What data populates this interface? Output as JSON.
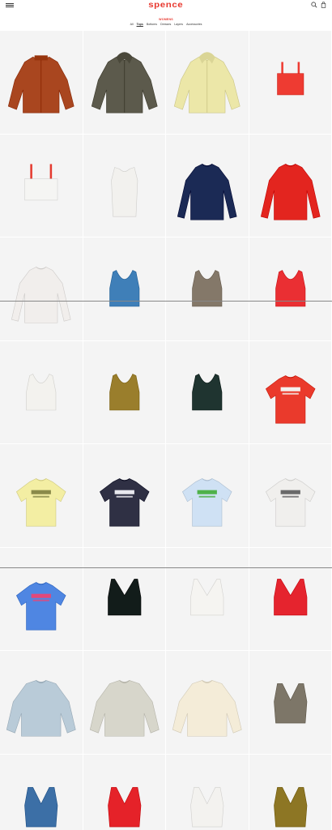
{
  "header": {
    "logo": "spence",
    "menu_icon": "hamburger-icon",
    "search_icon": "search-icon",
    "bag_icon": "bag-icon",
    "accent": "#e8382f"
  },
  "section_label": "WOMENS",
  "subnav": [
    "All",
    "Tops",
    "Bottoms",
    "Dresses",
    "Layers",
    "Accessories"
  ],
  "subnav_active": "Tops",
  "products": [
    {
      "type": "jacket",
      "color": "#a9461f",
      "pattern": true
    },
    {
      "type": "hoodie",
      "color": "#5c5a4c",
      "pattern": true
    },
    {
      "type": "hoodie",
      "color": "#ece7a8",
      "pattern": true
    },
    {
      "type": "crop",
      "color": "#ee3b32"
    },
    {
      "type": "bandeau",
      "color": "#f5f5f3",
      "strap": "#e43a2f"
    },
    {
      "type": "tank",
      "color": "#f2f1ee"
    },
    {
      "type": "longsleeve",
      "color": "#1b2a55"
    },
    {
      "type": "longsleeve",
      "color": "#e3251f"
    },
    {
      "type": "longsleeve",
      "color": "#f1eeec"
    },
    {
      "type": "racer",
      "color": "#3f7fb8"
    },
    {
      "type": "racer",
      "color": "#847869"
    },
    {
      "type": "racer",
      "color": "#ea2f33"
    },
    {
      "type": "racer",
      "color": "#f3f2ee"
    },
    {
      "type": "racer",
      "color": "#9a7e2c"
    },
    {
      "type": "racer",
      "color": "#1f3430"
    },
    {
      "type": "tee",
      "color": "#ea3a2c",
      "print": "#f4f0ee"
    },
    {
      "type": "tee",
      "color": "#f3eea3",
      "print": "#8a8a4a"
    },
    {
      "type": "tee",
      "color": "#2f3044",
      "print": "#e9e9ee"
    },
    {
      "type": "tee",
      "color": "#cfe1f4",
      "print": "#4fb24a"
    },
    {
      "type": "tee",
      "color": "#f0efed",
      "print": "#6a6a6a"
    },
    {
      "type": "tee",
      "color": "#4f86e2",
      "print": "#e2487a"
    },
    {
      "type": "vcrop",
      "color": "#121c1a"
    },
    {
      "type": "vcrop",
      "color": "#f5f4f1"
    },
    {
      "type": "vcrop",
      "color": "#e5242e"
    },
    {
      "type": "sweat",
      "color": "#b9cbd8",
      "pattern": true
    },
    {
      "type": "sweat",
      "color": "#d7d6cb",
      "pattern": true
    },
    {
      "type": "sweat",
      "color": "#f4ecd8",
      "pattern": true
    },
    {
      "type": "vtank",
      "color": "#7d7668"
    },
    {
      "type": "vtank",
      "color": "#3c6fa6"
    },
    {
      "type": "vtank",
      "color": "#e52229"
    },
    {
      "type": "vtank",
      "color": "#f3f2ef"
    },
    {
      "type": "vtank",
      "color": "#8d7624"
    }
  ]
}
